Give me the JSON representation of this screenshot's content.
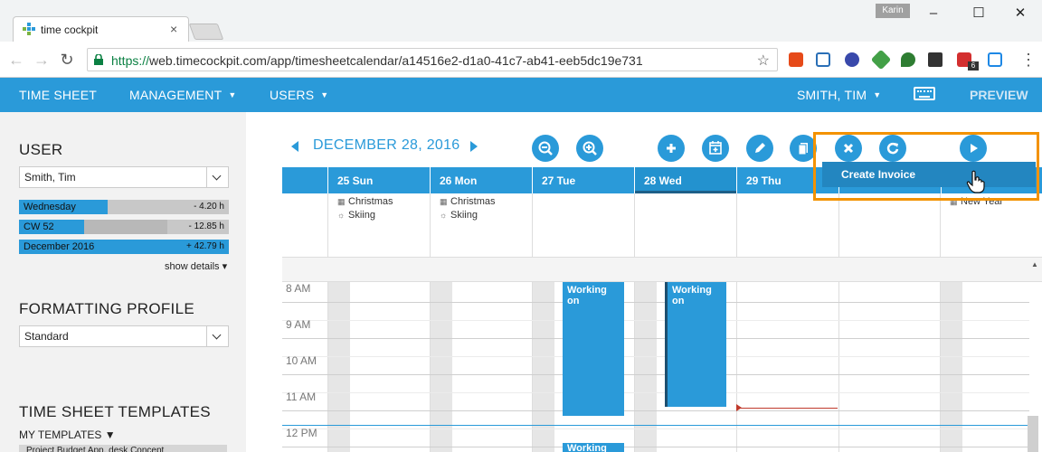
{
  "browser": {
    "tab_title": "time cockpit",
    "tab_close": "×",
    "profile_name": "Karin",
    "minimize": "–",
    "maximize": "☐",
    "close": "✕",
    "back": "←",
    "forward": "→",
    "reload": "↻",
    "url_scheme": "https://",
    "url_rest": "web.timecockpit.com/app/timesheetcalendar/a14516e2-d1a0-41c7-ab41-eeb5dc19e731",
    "bookmark": "☆",
    "ext_badge": "6",
    "menu": "⋮"
  },
  "appbar": {
    "nav": [
      "TIME SHEET",
      "MANAGEMENT",
      "USERS"
    ],
    "caret": "▼",
    "user": "SMITH, TIM",
    "preview": "PREVIEW",
    "accent": "#2a9ad9"
  },
  "left": {
    "user_heading": "USER",
    "user_value": "Smith, Tim",
    "bars": [
      {
        "label": "Wednesday",
        "value": "- 4.20 h",
        "fill": 0.42
      },
      {
        "label": "CW 52",
        "value": "- 12.85 h",
        "fill": 0.31
      },
      {
        "label": "December 2016",
        "value": "+ 42.79 h",
        "fill": 1.0
      }
    ],
    "show_details": "show details ▾",
    "profile_heading": "FORMATTING PROFILE",
    "profile_value": "Standard",
    "templates_heading": "TIME SHEET TEMPLATES",
    "my_templates": "MY TEMPLATES ▼",
    "template_item": "Project Budget App. desk Concept"
  },
  "calendar": {
    "date": "DECEMBER 28, 2016",
    "days": [
      "25 Sun",
      "26 Mon",
      "27 Tue",
      "28 Wed",
      "29 Thu"
    ],
    "allday_sun": [
      "Christmas",
      "Skiing"
    ],
    "allday_mon": [
      "Christmas",
      "Skiing"
    ],
    "allday_partial": "New Year",
    "allday_icon_cal": "▦",
    "allday_icon_sun": "☼",
    "scroll_up": "▲",
    "hours": [
      "8 AM",
      "9 AM",
      "10 AM",
      "11 AM",
      "12 PM"
    ],
    "events": [
      "Working on",
      "Working on",
      "Working on"
    ],
    "menu_item": "Create Invoice",
    "highlight_color": "#f39200"
  }
}
